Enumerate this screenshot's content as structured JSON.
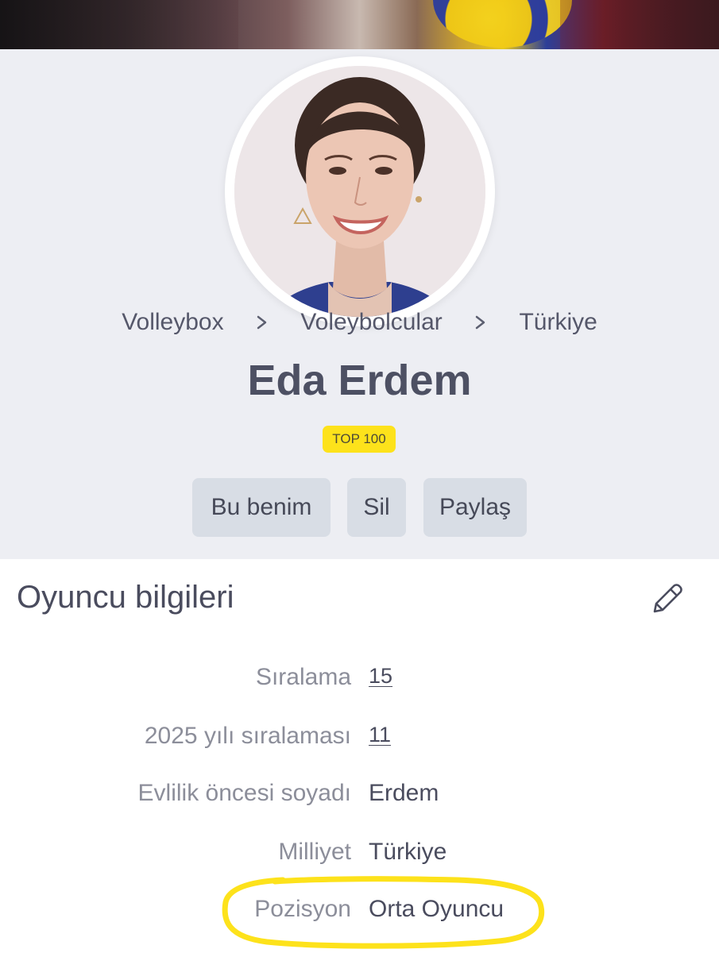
{
  "breadcrumb": [
    "Volleybox",
    "Voleybolcular",
    "Türkiye"
  ],
  "player": {
    "name": "Eda Erdem",
    "badge": "TOP 100"
  },
  "actions": {
    "claim_label": "Bu benim",
    "delete_label": "Sil",
    "share_label": "Paylaş"
  },
  "info": {
    "section_title": "Oyuncu bilgileri",
    "rows": [
      {
        "label": "Sıralama",
        "value": "15"
      },
      {
        "label": "2025 yılı sıralaması",
        "value": "11"
      },
      {
        "label": "Evlilik öncesi soyadı",
        "value": "Erdem"
      },
      {
        "label": "Milliyet",
        "value": "Türkiye"
      },
      {
        "label": "Pozisyon",
        "value": "Orta Oyuncu"
      }
    ]
  },
  "icons": {
    "breadcrumb_separator": "chevron-right-icon",
    "edit": "pencil-icon"
  },
  "colors": {
    "badge_bg": "#fde21b",
    "button_bg": "#d8dde5",
    "hero_bg": "#edeef3",
    "highlight": "#fde21b"
  }
}
